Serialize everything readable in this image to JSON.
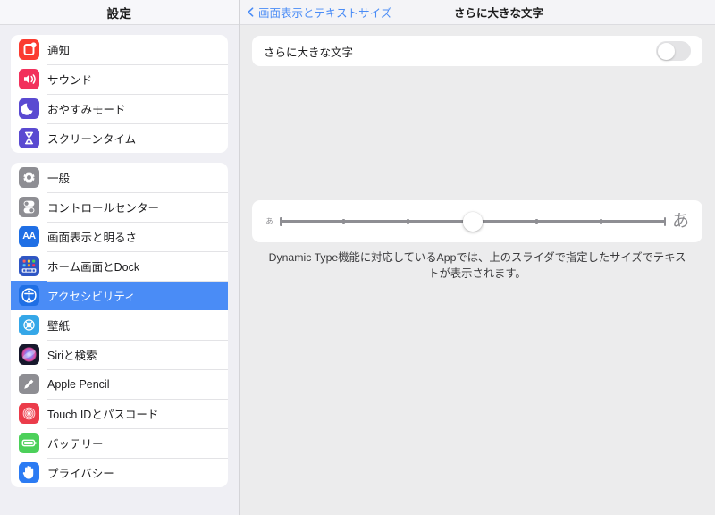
{
  "sidebar": {
    "title": "設定",
    "groups": [
      {
        "items": [
          {
            "label": "通知",
            "icon": "notifications-icon",
            "color": "#fb3b30"
          },
          {
            "label": "サウンド",
            "icon": "sound-icon",
            "color": "#f2315c"
          },
          {
            "label": "おやすみモード",
            "icon": "do-not-disturb-icon",
            "color": "#5a4ad1"
          },
          {
            "label": "スクリーンタイム",
            "icon": "screen-time-icon",
            "color": "#5a4ad1"
          }
        ]
      },
      {
        "items": [
          {
            "label": "一般",
            "icon": "gear-icon",
            "color": "#8e8e93"
          },
          {
            "label": "コントロールセンター",
            "icon": "control-center-icon",
            "color": "#8e8e93"
          },
          {
            "label": "画面表示と明るさ",
            "icon": "display-brightness-icon",
            "color": "#1f6fe5"
          },
          {
            "label": "ホーム画面とDock",
            "icon": "home-screen-dock-icon",
            "color": "#2f56c4"
          },
          {
            "label": "アクセシビリティ",
            "icon": "accessibility-icon",
            "color": "#1f6fe5",
            "selected": true
          },
          {
            "label": "壁紙",
            "icon": "wallpaper-icon",
            "color": "#35a7e8"
          },
          {
            "label": "Siriと検索",
            "icon": "siri-search-icon",
            "color": "#1c1c2e"
          },
          {
            "label": "Apple Pencil",
            "icon": "apple-pencil-icon",
            "color": "#8e8e93"
          },
          {
            "label": "Touch IDとパスコード",
            "icon": "touch-id-icon",
            "color": "#eb3b4a"
          },
          {
            "label": "バッテリー",
            "icon": "battery-icon",
            "color": "#4cd05a"
          },
          {
            "label": "プライバシー",
            "icon": "privacy-icon",
            "color": "#2b7bf3"
          }
        ]
      }
    ]
  },
  "nav": {
    "back_label": "画面表示とテキストサイズ",
    "title": "さらに大きな文字",
    "back_icon": "chevron-left-icon",
    "accent": "#4a8cf6"
  },
  "main": {
    "toggle": {
      "label": "さらに大きな文字",
      "value": "off"
    },
    "slider": {
      "small_label": "あ",
      "large_label": "あ",
      "value": 3,
      "min": 0,
      "max": 6,
      "tick_count": 7,
      "tick_positions_pct": [
        0,
        16.666,
        33.333,
        50,
        66.666,
        83.333,
        100
      ]
    },
    "footnote": "Dynamic Type機能に対応しているAppでは、上のスライダで指定したサイズでテキストが表示されます。"
  }
}
